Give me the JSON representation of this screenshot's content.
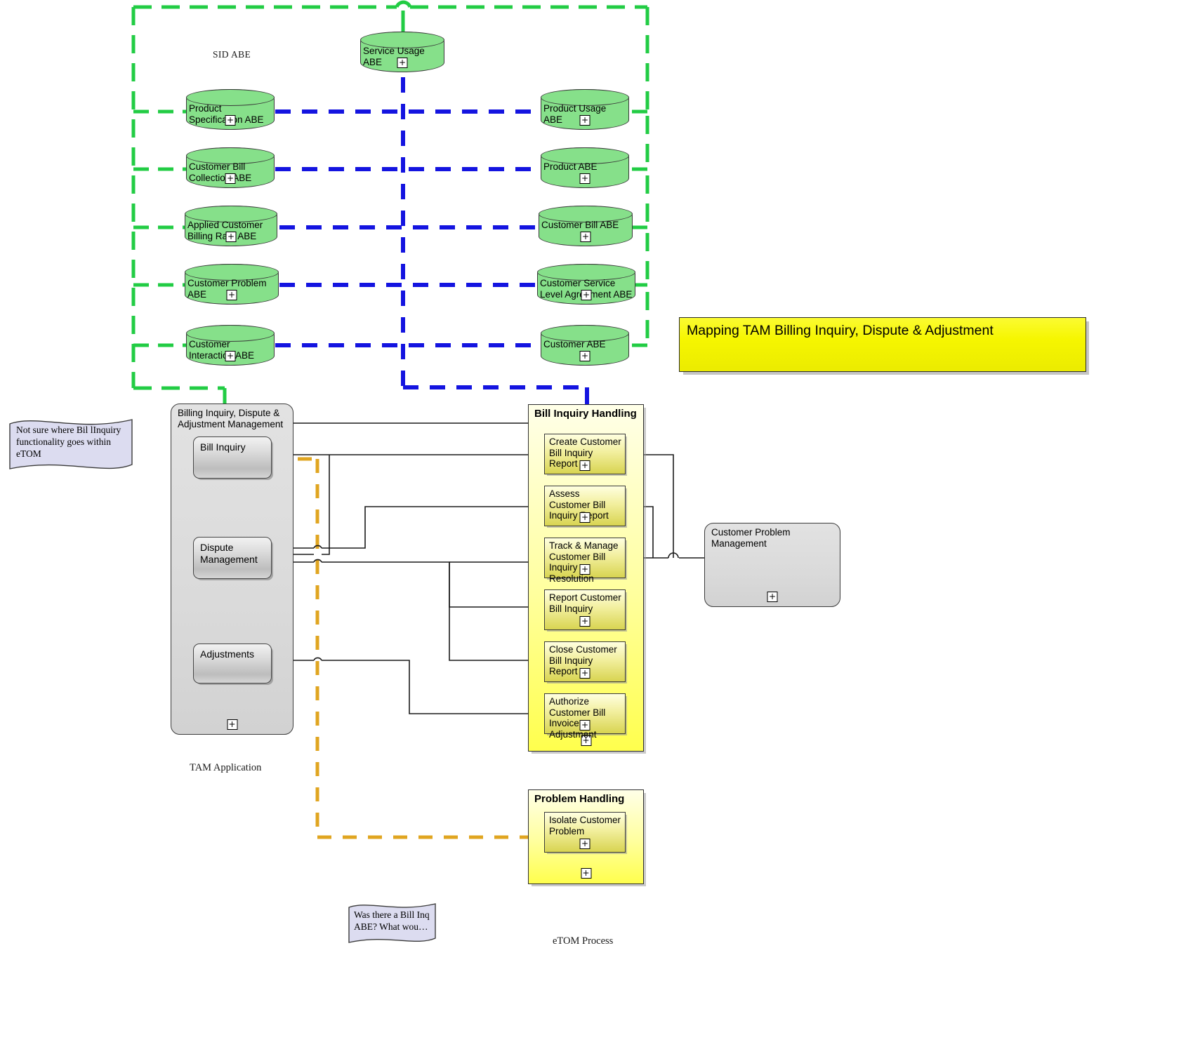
{
  "title_banner": {
    "text": "Mapping TAM Billing Inquiry, Dispute & Adjustment"
  },
  "labels": {
    "sid_abe": "SID ABE",
    "tam_application": "TAM Application",
    "etom_process": "eTOM Process"
  },
  "sid_abe_cylinders": [
    {
      "id": "service-usage-abe",
      "label": "Service Usage ABE"
    },
    {
      "id": "product-specification-abe",
      "label": "Product Specification ABE"
    },
    {
      "id": "product-usage-abe",
      "label": "Product Usage ABE"
    },
    {
      "id": "customer-bill-collection-abe",
      "label": "Customer Bill Collection ABE"
    },
    {
      "id": "product-abe",
      "label": "Product ABE"
    },
    {
      "id": "applied-customer-billing-rate-abe",
      "label": "Applied Customer Billing Rate ABE"
    },
    {
      "id": "customer-bill-abe",
      "label": "Customer Bill ABE"
    },
    {
      "id": "customer-problem-abe",
      "label": "Customer Problem ABE"
    },
    {
      "id": "customer-service-level-agreement-abe",
      "label": "Customer Service Level Agreement ABE"
    },
    {
      "id": "customer-interaction-abe",
      "label": "Customer Interaction ABE"
    },
    {
      "id": "customer-abe",
      "label": "Customer ABE"
    }
  ],
  "tam_application": {
    "container_title": "Billing Inquiry, Dispute & Adjustment Management",
    "nodes": [
      {
        "id": "bill-inquiry",
        "label": "Bill Inquiry"
      },
      {
        "id": "dispute-management",
        "label": "Dispute Management"
      },
      {
        "id": "adjustments",
        "label": "Adjustments"
      }
    ]
  },
  "bill_inquiry_handling": {
    "container_title": "Bill Inquiry Handling",
    "nodes": [
      {
        "id": "create-customer-bill-inquiry-report",
        "label": "Create Customer Bill Inquiry Report"
      },
      {
        "id": "assess-customer-bill-inquiry-report",
        "label": "Assess Customer Bill Inquiry Report"
      },
      {
        "id": "track-manage-customer-bill-inquiry-resolution",
        "label": "Track & Manage Customer Bill Inquiry Resolution"
      },
      {
        "id": "report-customer-bill-inquiry",
        "label": "Report Customer Bill Inquiry"
      },
      {
        "id": "close-customer-bill-inquiry-report",
        "label": "Close Customer Bill Inquiry Report"
      },
      {
        "id": "authorize-customer-bill-invoice-adjustment",
        "label": "Authorize Customer Bill Invoice Adjustment"
      }
    ]
  },
  "problem_handling": {
    "container_title": "Problem Handling",
    "nodes": [
      {
        "id": "isolate-customer-problem",
        "label": "Isolate Customer Problem"
      }
    ]
  },
  "customer_problem_management": {
    "title": "Customer Problem Management"
  },
  "notes": [
    {
      "id": "note-bill-inquiry-etom",
      "text": "Not sure where Bil lInquiry functionality goes within eTOM"
    },
    {
      "id": "note-bill-inq-abe",
      "text": "Was there a Bill Inq ABE?  What wou…"
    }
  ],
  "colors": {
    "sid_boundary": "#22cc44",
    "blue_connector": "#1414e0",
    "orange_connector": "#e0a520",
    "cylinder_fill": "#86e08a",
    "banner_fill": "#f6f600",
    "note_fill": "#dcdcf0"
  },
  "icons": {
    "expand": "plus-icon"
  }
}
